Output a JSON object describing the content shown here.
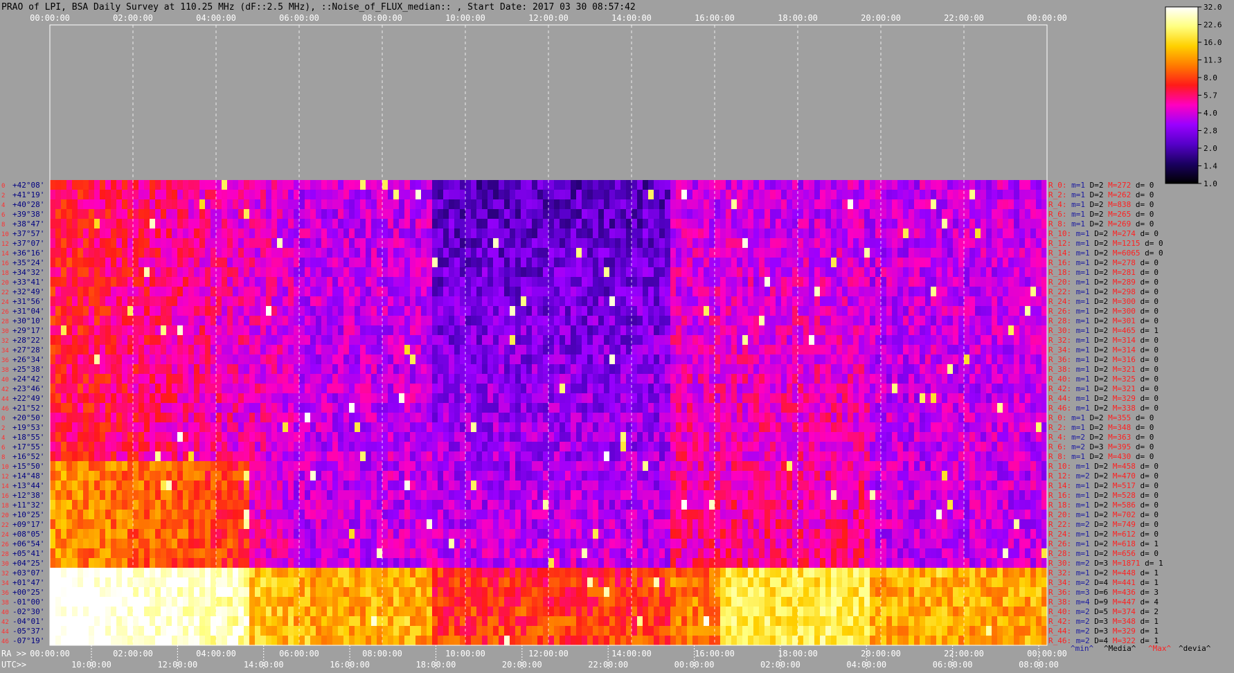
{
  "title": "PRAO of LPI, BSA Daily Survey at 110.25 MHz (dF::2.5 MHz), ::Noise_of_FLUX_median:: , Start Date: 2017 03 30 08:57:42",
  "top_axis": {
    "ticks": [
      "00:00:00",
      "02:00:00",
      "04:00:00",
      "06:00:00",
      "08:00:00",
      "10:00:00",
      "12:00:00",
      "14:00:00",
      "16:00:00",
      "18:00:00",
      "20:00:00",
      "22:00:00",
      "00:00:00"
    ]
  },
  "ra_axis": {
    "prefix": "RA >>",
    "ticks": [
      "00:00:00",
      "02:00:00",
      "04:00:00",
      "06:00:00",
      "08:00:00",
      "10:00:00",
      "12:00:00",
      "14:00:00",
      "16:00:00",
      "18:00:00",
      "20:00:00",
      "22:00:00",
      "00:00:00"
    ]
  },
  "utc_axis": {
    "prefix": "UTC>>",
    "ticks": [
      "10:00:00",
      "12:00:00",
      "14:00:00",
      "16:00:00",
      "18:00:00",
      "20:00:00",
      "22:00:00",
      "00:00:00",
      "02:00:00",
      "04:00:00",
      "06:00:00",
      "08:00:00"
    ]
  },
  "colorbar": {
    "ticks": [
      "32.0",
      "22.6",
      "16.0",
      "11.3",
      "8.0",
      "5.7",
      "4.0",
      "2.8",
      "2.0",
      "1.4",
      "1.0"
    ],
    "colors": [
      "#000000",
      "#1a0060",
      "#5500c8",
      "#9a00ff",
      "#ff00c0",
      "#ff1a1a",
      "#ff7a00",
      "#ffd000",
      "#ffff80",
      "#ffffff"
    ]
  },
  "legend": {
    "min": "^min^",
    "median": "^Media^",
    "max": "^Max^",
    "devia": "^devia^"
  },
  "chart_data": {
    "type": "heatmap",
    "title": "PRAO of LPI, BSA Daily Survey at 110.25 MHz (dF::2.5 MHz), ::Noise_of_FLUX_median:: , Start Date: 2017 03 30 08:57:42",
    "x_axis": "RA / UTC, 24 h",
    "value_range": [
      1.0,
      32.0
    ],
    "beam_numbers": [
      "0",
      "2",
      "4",
      "6",
      "8",
      "10",
      "12",
      "14",
      "16",
      "18",
      "20",
      "22",
      "24",
      "26",
      "28",
      "30",
      "32",
      "34",
      "36",
      "38",
      "40",
      "42",
      "44",
      "46",
      "0",
      "2",
      "4",
      "6",
      "8",
      "10",
      "12",
      "14",
      "16",
      "18",
      "20",
      "22",
      "24",
      "26",
      "28",
      "30",
      "32",
      "34",
      "36",
      "38",
      "40",
      "42",
      "44",
      "46"
    ],
    "declinations": [
      "+42°08'",
      "+41°19'",
      "+40°28'",
      "+39°38'",
      "+38°47'",
      "+37°57'",
      "+37°07'",
      "+36°16'",
      "+35°24'",
      "+34°32'",
      "+33°41'",
      "+32°49'",
      "+31°56'",
      "+31°04'",
      "+30°10'",
      "+29°17'",
      "+28°22'",
      "+27°28'",
      "+26°34'",
      "+25°38'",
      "+24°42'",
      "+23°46'",
      "+22°49'",
      "+21°52'",
      "+20°50'",
      "+19°53'",
      "+18°55'",
      "+17°55'",
      "+16°52'",
      "+15°50'",
      "+14°48'",
      "+13°44'",
      "+12°38'",
      "+11°32'",
      "+10°25'",
      "+09°17'",
      "+08°05'",
      "+06°54'",
      "+05°41'",
      "+04°25'",
      "+03°07'",
      "+01°47'",
      "+00°25'",
      "-01°00'",
      "-02°30'",
      "-04°01'",
      "-05°37'",
      "-07°19'"
    ],
    "stats": [
      {
        "r": "R_0:",
        "m": "m=1",
        "D": "D=2",
        "M": "M=272",
        "d": "d= 0"
      },
      {
        "r": "R_2:",
        "m": "m=1",
        "D": "D=2",
        "M": "M=262",
        "d": "d= 0"
      },
      {
        "r": "R_4:",
        "m": "m=1",
        "D": "D=2",
        "M": "M=838",
        "d": "d= 0"
      },
      {
        "r": "R_6:",
        "m": "m=1",
        "D": "D=2",
        "M": "M=265",
        "d": "d= 0"
      },
      {
        "r": "R_8:",
        "m": "m=1",
        "D": "D=2",
        "M": "M=269",
        "d": "d= 0"
      },
      {
        "r": "R_10:",
        "m": "m=1",
        "D": "D=2",
        "M": "M=274",
        "d": "d= 0"
      },
      {
        "r": "R_12:",
        "m": "m=1",
        "D": "D=2",
        "M": "M=1215",
        "d": "d= 0"
      },
      {
        "r": "R_14:",
        "m": "m=1",
        "D": "D=2",
        "M": "M=6065",
        "d": "d= 0"
      },
      {
        "r": "R_16:",
        "m": "m=1",
        "D": "D=2",
        "M": "M=278",
        "d": "d= 0"
      },
      {
        "r": "R_18:",
        "m": "m=1",
        "D": "D=2",
        "M": "M=281",
        "d": "d= 0"
      },
      {
        "r": "R_20:",
        "m": "m=1",
        "D": "D=2",
        "M": "M=289",
        "d": "d= 0"
      },
      {
        "r": "R_22:",
        "m": "m=1",
        "D": "D=2",
        "M": "M=298",
        "d": "d= 0"
      },
      {
        "r": "R_24:",
        "m": "m=1",
        "D": "D=2",
        "M": "M=300",
        "d": "d= 0"
      },
      {
        "r": "R_26:",
        "m": "m=1",
        "D": "D=2",
        "M": "M=300",
        "d": "d= 0"
      },
      {
        "r": "R_28:",
        "m": "m=1",
        "D": "D=2",
        "M": "M=301",
        "d": "d= 0"
      },
      {
        "r": "R_30:",
        "m": "m=1",
        "D": "D=2",
        "M": "M=465",
        "d": "d= 1"
      },
      {
        "r": "R_32:",
        "m": "m=1",
        "D": "D=2",
        "M": "M=314",
        "d": "d= 0"
      },
      {
        "r": "R_34:",
        "m": "m=1",
        "D": "D=2",
        "M": "M=314",
        "d": "d= 0"
      },
      {
        "r": "R_36:",
        "m": "m=1",
        "D": "D=2",
        "M": "M=316",
        "d": "d= 0"
      },
      {
        "r": "R_38:",
        "m": "m=1",
        "D": "D=2",
        "M": "M=321",
        "d": "d= 0"
      },
      {
        "r": "R_40:",
        "m": "m=1",
        "D": "D=2",
        "M": "M=325",
        "d": "d= 0"
      },
      {
        "r": "R_42:",
        "m": "m=1",
        "D": "D=2",
        "M": "M=321",
        "d": "d= 0"
      },
      {
        "r": "R_44:",
        "m": "m=1",
        "D": "D=2",
        "M": "M=329",
        "d": "d= 0"
      },
      {
        "r": "R_46:",
        "m": "m=1",
        "D": "D=2",
        "M": "M=338",
        "d": "d= 0"
      },
      {
        "r": "R_0:",
        "m": "m=1",
        "D": "D=2",
        "M": "M=355",
        "d": "d= 0"
      },
      {
        "r": "R_2:",
        "m": "m=1",
        "D": "D=2",
        "M": "M=348",
        "d": "d= 0"
      },
      {
        "r": "R_4:",
        "m": "m=2",
        "D": "D=2",
        "M": "M=363",
        "d": "d= 0"
      },
      {
        "r": "R_6:",
        "m": "m=2",
        "D": "D=3",
        "M": "M=395",
        "d": "d= 0"
      },
      {
        "r": "R_8:",
        "m": "m=1",
        "D": "D=2",
        "M": "M=430",
        "d": "d= 0"
      },
      {
        "r": "R_10:",
        "m": "m=1",
        "D": "D=2",
        "M": "M=458",
        "d": "d= 0"
      },
      {
        "r": "R_12:",
        "m": "m=2",
        "D": "D=2",
        "M": "M=470",
        "d": "d= 0"
      },
      {
        "r": "R_14:",
        "m": "m=1",
        "D": "D=2",
        "M": "M=517",
        "d": "d= 0"
      },
      {
        "r": "R_16:",
        "m": "m=1",
        "D": "D=2",
        "M": "M=528",
        "d": "d= 0"
      },
      {
        "r": "R_18:",
        "m": "m=1",
        "D": "D=2",
        "M": "M=586",
        "d": "d= 0"
      },
      {
        "r": "R_20:",
        "m": "m=1",
        "D": "D=2",
        "M": "M=702",
        "d": "d= 0"
      },
      {
        "r": "R_22:",
        "m": "m=2",
        "D": "D=2",
        "M": "M=749",
        "d": "d= 0"
      },
      {
        "r": "R_24:",
        "m": "m=1",
        "D": "D=2",
        "M": "M=612",
        "d": "d= 0"
      },
      {
        "r": "R_26:",
        "m": "m=1",
        "D": "D=2",
        "M": "M=618",
        "d": "d= 1"
      },
      {
        "r": "R_28:",
        "m": "m=1",
        "D": "D=2",
        "M": "M=656",
        "d": "d= 0"
      },
      {
        "r": "R_30:",
        "m": "m=2",
        "D": "D=3",
        "M": "M=1871",
        "d": "d= 1"
      },
      {
        "r": "R_32:",
        "m": "m=1",
        "D": "D=2",
        "M": "M=448",
        "d": "d= 1"
      },
      {
        "r": "R_34:",
        "m": "m=2",
        "D": "D=4",
        "M": "M=441",
        "d": "d= 1"
      },
      {
        "r": "R_36:",
        "m": "m=3",
        "D": "D=6",
        "M": "M=436",
        "d": "d= 3"
      },
      {
        "r": "R_38:",
        "m": "m=4",
        "D": "D=9",
        "M": "M=447",
        "d": "d= 4"
      },
      {
        "r": "R_40:",
        "m": "m=2",
        "D": "D=5",
        "M": "M=374",
        "d": "d= 2"
      },
      {
        "r": "R_42:",
        "m": "m=2",
        "D": "D=3",
        "M": "M=348",
        "d": "d= 1"
      },
      {
        "r": "R_44:",
        "m": "m=2",
        "D": "D=3",
        "M": "M=329",
        "d": "d= 1"
      },
      {
        "r": "R_46:",
        "m": "m=2",
        "D": "D=4",
        "M": "M=322",
        "d": "d= 1"
      }
    ]
  }
}
